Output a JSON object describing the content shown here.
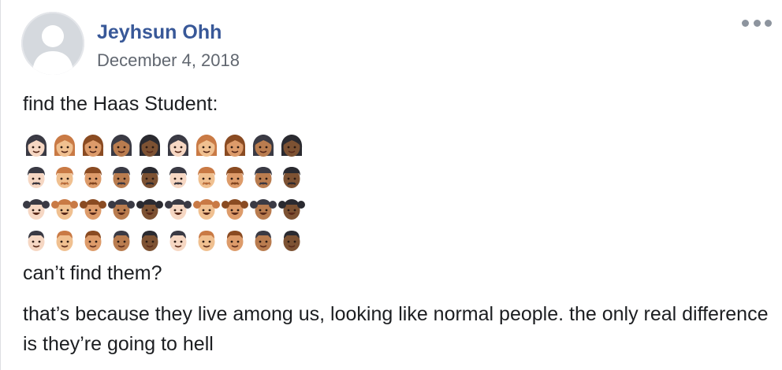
{
  "post": {
    "author": "Jeyhsun Ohh",
    "date": "December 4, 2018",
    "avatar_icon": "default-profile-silhouette-icon",
    "more_icon": "ellipsis-icon",
    "line1": "find the Haas Student:",
    "line2": "can’t find them?",
    "line3": "that’s because they live among us, looking like normal people. the only real difference is they’re going to hell"
  },
  "emoji_grid": {
    "skin_tones": [
      "#f6d7c3",
      "#f0c090",
      "#dd9b6a",
      "#b97c4f",
      "#7d5233"
    ],
    "rows": [
      {
        "kind": "woman",
        "icon": "woman-emoji-icon",
        "count": 10
      },
      {
        "kind": "man",
        "icon": "man-emoji-icon",
        "count": 10
      },
      {
        "kind": "girl",
        "icon": "girl-emoji-icon",
        "count": 10
      },
      {
        "kind": "boy",
        "icon": "boy-emoji-icon",
        "count": 10
      }
    ],
    "hair_colors": [
      "#3a3a44",
      "#c97a45",
      "#8a4b22",
      "#3a3a44",
      "#2a2a30"
    ]
  },
  "colors": {
    "author": "#385898",
    "date": "#616770",
    "text": "#1c1e21"
  }
}
